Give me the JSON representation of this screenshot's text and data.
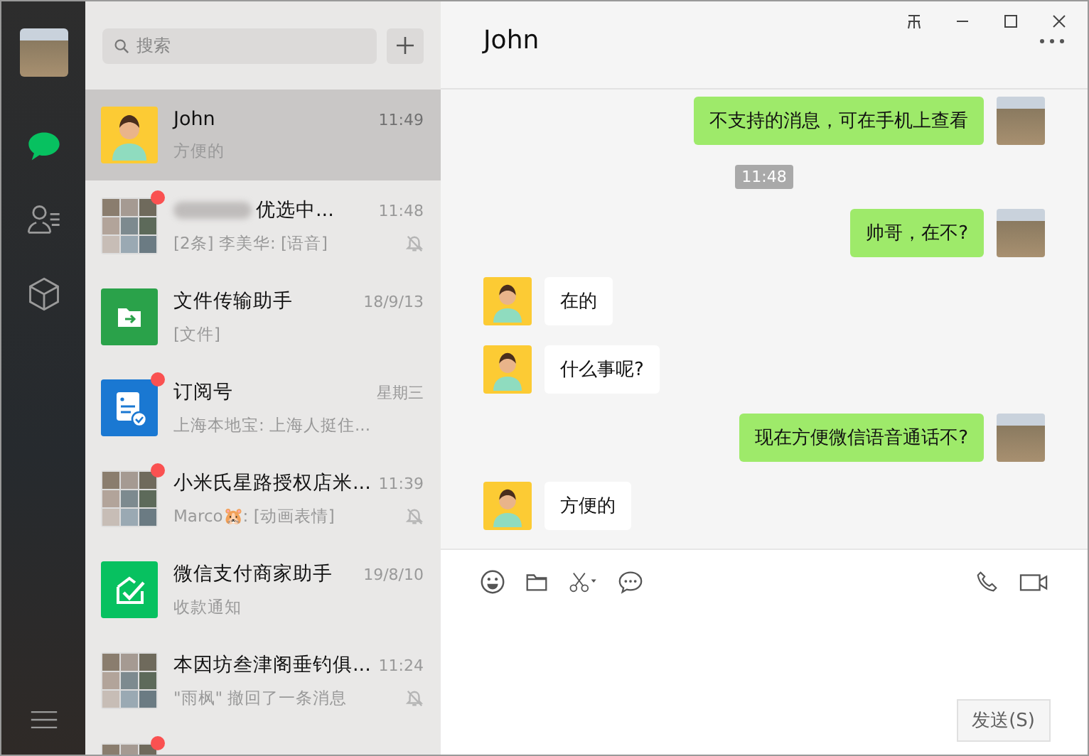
{
  "sidebar": {
    "items": [
      {
        "kind": "chat",
        "selected": true
      },
      {
        "kind": "contacts",
        "selected": false
      },
      {
        "kind": "box",
        "selected": false
      }
    ]
  },
  "search": {
    "placeholder": "搜索"
  },
  "chats": [
    {
      "kind": "cartoon",
      "title": "John",
      "preview": "方便的",
      "time": "11:49",
      "selected": true,
      "unread": false,
      "muted": false,
      "blurred": false
    },
    {
      "kind": "group",
      "title": "优选中...",
      "preview": "[2条] 李美华: [语音]",
      "time": "11:48",
      "selected": false,
      "unread": true,
      "muted": true,
      "blurred": true
    },
    {
      "kind": "file",
      "title": "文件传输助手",
      "preview": "[文件]",
      "time": "18/9/13",
      "selected": false,
      "unread": false,
      "muted": false,
      "blurred": false
    },
    {
      "kind": "subscription",
      "title": "订阅号",
      "preview": "上海本地宝: 上海人挺住...",
      "time": "星期三",
      "selected": false,
      "unread": true,
      "muted": false,
      "blurred": false
    },
    {
      "kind": "group",
      "title": "小米氏星路授权店米...",
      "preview": "Marco🐹: [动画表情]",
      "time": "11:39",
      "selected": false,
      "unread": true,
      "muted": true,
      "blurred": false
    },
    {
      "kind": "pay",
      "title": "微信支付商家助手",
      "preview": "收款通知",
      "time": "19/8/10",
      "selected": false,
      "unread": false,
      "muted": false,
      "blurred": false
    },
    {
      "kind": "group",
      "title": "本因坊叁津阁垂钓俱...",
      "preview": "\"雨枫\" 撤回了一条消息",
      "time": "11:24",
      "selected": false,
      "unread": false,
      "muted": true,
      "blurred": false
    },
    {
      "kind": "group",
      "selected": false,
      "unread": true,
      "muted": false,
      "blurred": false
    }
  ],
  "conversation": {
    "title": "John",
    "messages": [
      {
        "kind": "sent",
        "text": "不支持的消息，可在手机上查看"
      },
      {
        "kind": "time",
        "text": "11:48"
      },
      {
        "kind": "sent",
        "text": "帅哥，在不?"
      },
      {
        "kind": "received",
        "text": "在的"
      },
      {
        "kind": "received",
        "text": "什么事呢?"
      },
      {
        "kind": "sent",
        "text": "现在方便微信语音通话不?"
      },
      {
        "kind": "received",
        "text": "方便的"
      }
    ]
  },
  "send_button": "发送(S)"
}
